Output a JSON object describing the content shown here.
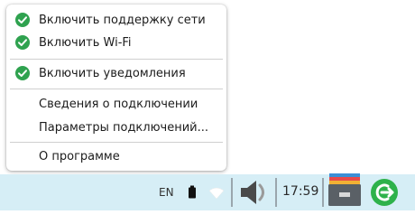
{
  "menu": {
    "items": [
      {
        "label": "Включить поддержку сети",
        "checked": true
      },
      {
        "label": "Включить Wi-Fi",
        "checked": true
      },
      {
        "label": "Включить уведомления",
        "checked": true
      },
      {
        "label": "Сведения о подключении",
        "checked": false
      },
      {
        "label": "Параметры подключений...",
        "checked": false
      },
      {
        "label": "О программе",
        "checked": false
      }
    ]
  },
  "taskbar": {
    "language": "EN",
    "time": "17:59",
    "icons": [
      "battery-icon",
      "wifi-icon",
      "volume-icon",
      "file-manager-icon",
      "session-logout-icon"
    ]
  },
  "colors": {
    "check_green": "#2fa24f",
    "taskbar_bg": "#d6eef6",
    "logout_green": "#2eb24b"
  }
}
